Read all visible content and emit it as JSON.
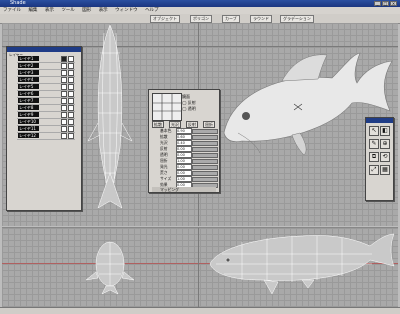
{
  "window": {
    "title": "Shade",
    "controls": [
      "_",
      "□",
      "×"
    ]
  },
  "menu": [
    "ファイル",
    "編集",
    "表示",
    "ツール",
    "図形",
    "表示",
    "ウィンドウ",
    "ヘルプ"
  ],
  "toolbar": {
    "items": [
      "オブジェクト",
      "ポリゴン",
      "カーブ",
      "ラウンド",
      "グラデーション"
    ]
  },
  "layer_panel": {
    "header": "レイヤー",
    "rows": [
      "レイヤ1",
      "レイヤ2",
      "レイヤ3",
      "レイヤ4",
      "レイヤ5",
      "レイヤ6",
      "レイヤ7",
      "レイヤ8",
      "レイヤ9",
      "レイヤ10",
      "レイヤ11",
      "レイヤ12"
    ]
  },
  "property_panel": {
    "options": [
      "鏡面",
      "◯ 反射",
      "◯ 透明"
    ],
    "tabs": [
      "拡散",
      "光沢",
      "反射",
      "屈折"
    ],
    "rows": [
      {
        "label": "基本色",
        "value": "0.90"
      },
      {
        "label": "拡散",
        "value": "0.60"
      },
      {
        "label": "光沢",
        "value": "0.40"
      },
      {
        "label": "反射",
        "value": "0.00"
      },
      {
        "label": "透明",
        "value": "0.00"
      },
      {
        "label": "屈折",
        "value": "1.00"
      },
      {
        "label": "発光",
        "value": "0.00"
      },
      {
        "label": "荒さ",
        "value": "0.00"
      },
      {
        "label": "サイズ",
        "value": "1.00"
      },
      {
        "label": "効果",
        "value": "0.00"
      },
      {
        "label": "マッピング",
        "value": ""
      }
    ]
  },
  "tool_panel": {
    "tools": [
      "↖",
      "◧",
      "✎",
      "⊕",
      "⧉",
      "⟲",
      "⤢",
      "▦"
    ]
  },
  "status": {
    "text": ""
  }
}
